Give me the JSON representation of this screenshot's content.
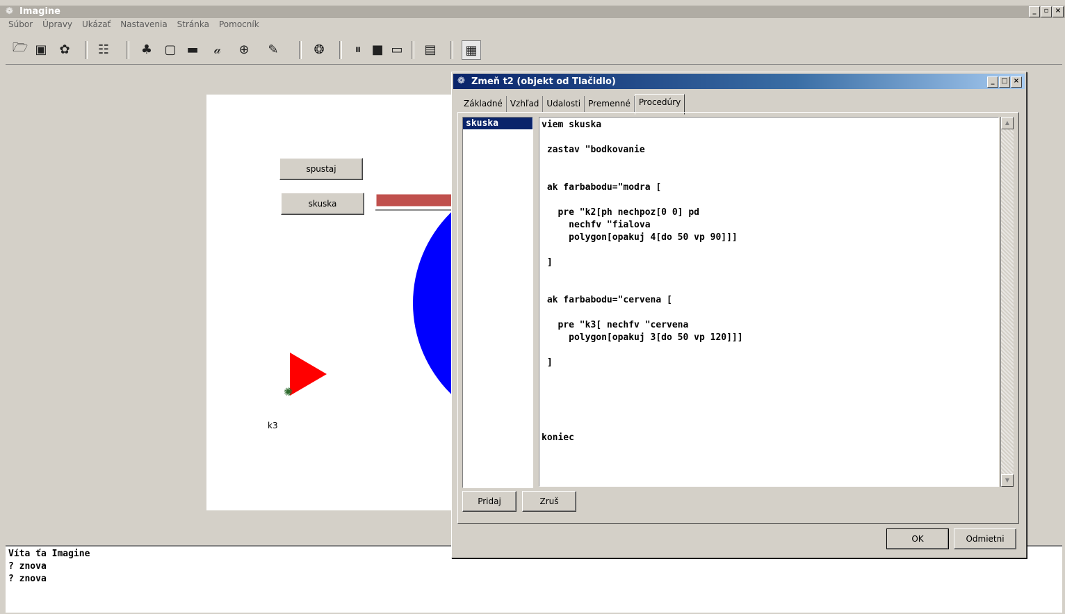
{
  "app": {
    "title": "Imagine",
    "min_label": "_",
    "restore_label": "▫",
    "close_label": "×"
  },
  "menu": [
    "Súbor",
    "Úpravy",
    "Ukázať",
    "Nastavenia",
    "Stránka",
    "Pomocník"
  ],
  "toolbar_icons": [
    "open-folder-icon",
    "save-icon",
    "turtle-props-icon",
    "list-icon",
    "turtle-icon",
    "frame-icon",
    "rect-icon",
    "text-icon",
    "compass-icon",
    "pen-icon",
    "turtle-gear-icon",
    "pause-icon",
    "stop-icon",
    "run-icon",
    "page-icon",
    "image-icon"
  ],
  "canvas": {
    "button1": "spustaj",
    "button2": "skuska",
    "turtle_label": "k3",
    "colors": {
      "shape": "#ff0000",
      "disc": "#0000ff",
      "arrow": "#c0504d"
    }
  },
  "console": {
    "lines": [
      "Víta ťa Imagine",
      "? znova",
      "? znova"
    ]
  },
  "dialog": {
    "title": "Zmeň t2 (objekt od Tlačidlo)",
    "tabs": [
      "Základné",
      "Vzhľad",
      "Udalosti",
      "Premenné",
      "Procedúry"
    ],
    "active_tab": "Procedúry",
    "procedures": [
      "skuska"
    ],
    "code": "viem skuska\n\n zastav \"bodkovanie\n\n\n ak farbabodu=\"modra [\n\n   pre \"k2[ph nechpoz[0 0] pd\n     nechfv \"fialova\n     polygon[opakuj 4[do 50 vp 90]]]\n\n ]\n\n\n ak farbabodu=\"cervena [\n\n   pre \"k3[ nechfv \"cervena\n     polygon[opakuj 3[do 50 vp 120]]]\n\n ]\n\n\n\n\n\nkoniec",
    "add_label": "Pridaj",
    "remove_label": "Zruš",
    "ok_label": "OK",
    "cancel_label": "Odmietni"
  }
}
